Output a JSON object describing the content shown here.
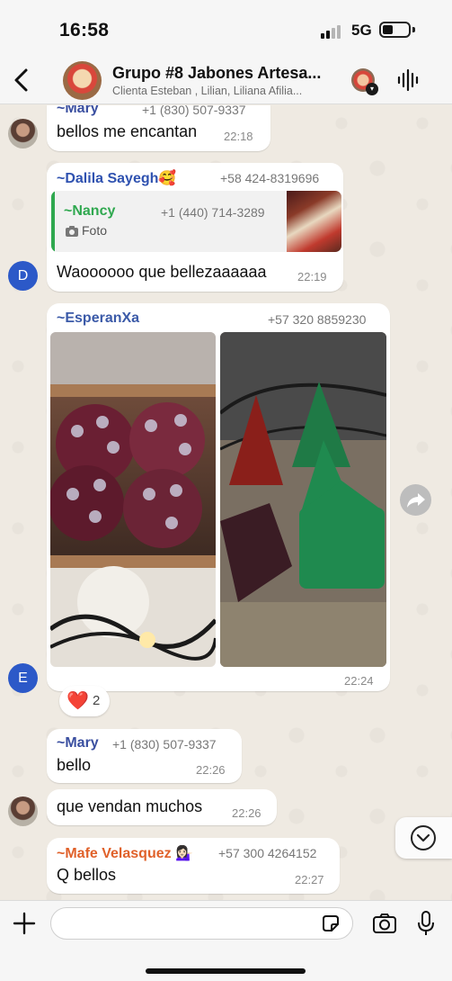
{
  "status_bar": {
    "time": "16:58",
    "network": "5G"
  },
  "header": {
    "title": "Grupo #8 Jabones Artesa...",
    "members": "Clienta Esteban , Lilian, Liliana Afilia..."
  },
  "colors": {
    "mary": "#3a4fa0",
    "dalila": "#2f52b0",
    "nancy": "#2fa84f",
    "esperanxa": "#3b5aa8",
    "mafe": "#e0612a",
    "avatar_d": "#2c59c8",
    "avatar_e": "#2c59c8",
    "chat_bg": "#efeae2"
  },
  "messages": [
    {
      "sender": "~Mary",
      "phone": "+1 (830) 507-9337",
      "text": "bellos me encantan",
      "time": "22:18"
    },
    {
      "sender": "~Dalila Sayegh🥰",
      "phone": "+58 424-8319696",
      "quote": {
        "sender": "~Nancy",
        "phone": "+1 (440) 714-3289",
        "label": "Foto",
        "icon": "camera-icon"
      },
      "text": "Waoooooo que bellezaaaaaa",
      "time": "22:19",
      "avatar_letter": "D"
    },
    {
      "sender": "~EsperanXa",
      "phone": "+57 320 8859230",
      "time": "22:24",
      "avatar_letter": "E",
      "reaction": {
        "emoji": "❤️",
        "count": "2"
      }
    },
    {
      "sender": "~Mary",
      "phone": "+1 (830) 507-9337",
      "text": "bello",
      "time": "22:26"
    },
    {
      "text": "que vendan muchos",
      "time": "22:26"
    },
    {
      "sender": "~Mafe Velasquez 💁🏻‍♀️",
      "phone": "+57 300 4264152",
      "text": "Q bellos",
      "time": "22:27"
    }
  ],
  "input": {
    "placeholder": ""
  },
  "icons": [
    "back-icon",
    "voice-wave-icon",
    "forward-icon",
    "chevron-down-icon",
    "plus-icon",
    "sticker-icon",
    "camera-icon",
    "mic-icon"
  ]
}
